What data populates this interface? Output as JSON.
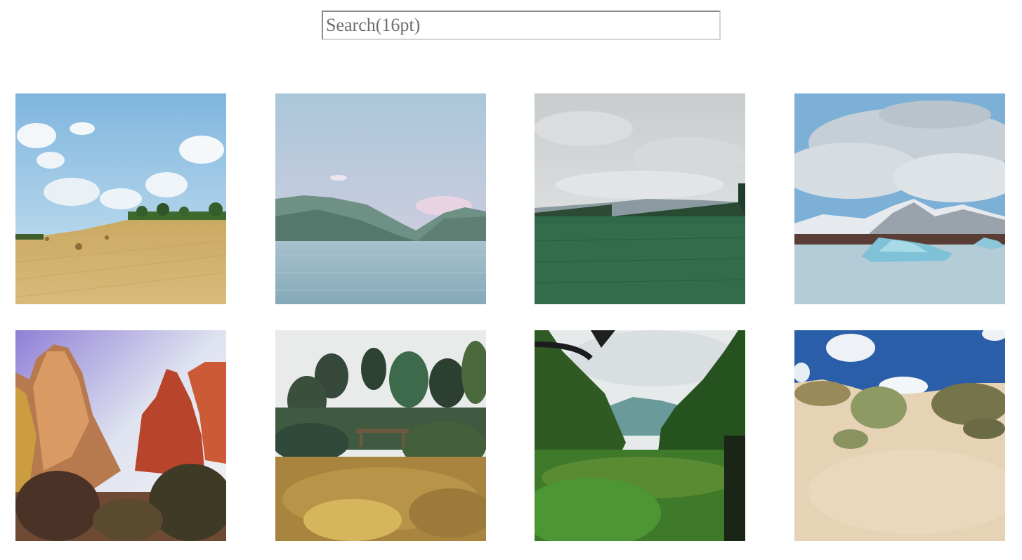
{
  "search": {
    "placeholder": "Search(16pt)",
    "value": ""
  },
  "gallery": {
    "images": [
      {
        "icon": "wheat-field-image"
      },
      {
        "icon": "mountain-lake-image"
      },
      {
        "icon": "green-meadow-image"
      },
      {
        "icon": "glacier-lagoon-image"
      },
      {
        "icon": "red-rock-canyon-image"
      },
      {
        "icon": "garden-trees-image"
      },
      {
        "icon": "jungle-valley-image"
      },
      {
        "icon": "sand-dunes-image"
      }
    ]
  }
}
